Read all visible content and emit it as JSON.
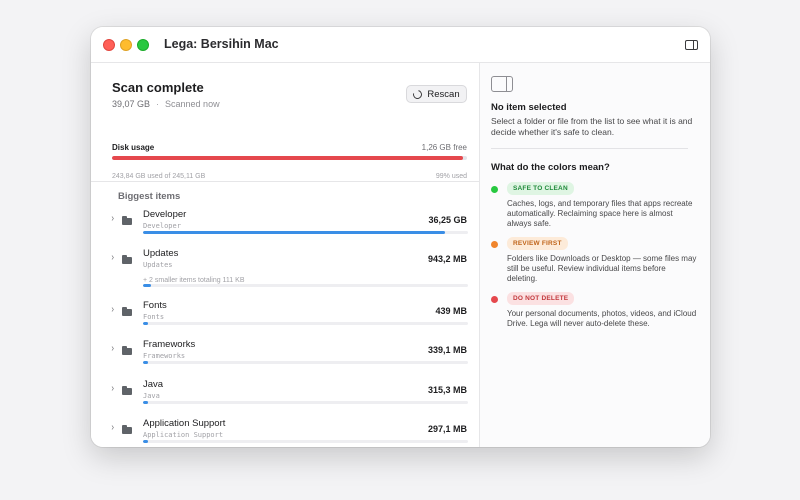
{
  "window": {
    "title": "Lega: Bersihin Mac"
  },
  "scan": {
    "title": "Scan complete",
    "size": "39,07 GB",
    "separator": "·",
    "status": "Scanned now",
    "rescan_label": "Rescan"
  },
  "disk": {
    "label": "Disk usage",
    "free": "1,26 GB free",
    "used_text": "243,84 GB used of 245,11 GB",
    "percent_text": "99% used",
    "used_fraction": 0.99
  },
  "biggest_title": "Biggest items",
  "items": [
    {
      "name": "Developer",
      "path": "Developer",
      "size": "36,25 GB",
      "fraction": 0.93,
      "extra": ""
    },
    {
      "name": "Updates",
      "path": "Updates",
      "size": "943,2 MB",
      "fraction": 0.026,
      "extra": "+ 2 smaller items totaling 111 KB"
    },
    {
      "name": "Fonts",
      "path": "Fonts",
      "size": "439 MB",
      "fraction": 0.012,
      "extra": ""
    },
    {
      "name": "Frameworks",
      "path": "Frameworks",
      "size": "339,1 MB",
      "fraction": 0.009,
      "extra": ""
    },
    {
      "name": "Java",
      "path": "Java",
      "size": "315,3 MB",
      "fraction": 0.009,
      "extra": ""
    },
    {
      "name": "Application Support",
      "path": "Application Support",
      "size": "297,1 MB",
      "fraction": 0.008,
      "extra": ""
    }
  ],
  "inspector": {
    "title": "No item selected",
    "desc": "Select a folder or file from the list to see what it is and decide whether it's safe to clean.",
    "colors_title": "What do the colors mean?",
    "legend": [
      {
        "badge": "SAFE TO CLEAN",
        "color": "#28c840",
        "badge_bg": "#dff5e3",
        "badge_fg": "#1f8a3a",
        "desc": "Caches, logs, and temporary files that apps recreate automatically. Reclaiming space here is almost always safe."
      },
      {
        "badge": "REVIEW FIRST",
        "color": "#f0852d",
        "badge_bg": "#fdebd9",
        "badge_fg": "#c0651b",
        "desc": "Folders like Downloads or Desktop — some files may still be useful. Review individual items before deleting."
      },
      {
        "badge": "DO NOT DELETE",
        "color": "#e5484d",
        "badge_bg": "#fbe1e2",
        "badge_fg": "#c2383c",
        "desc": "Your personal documents, photos, videos, and iCloud Drive. Lega will never auto-delete these."
      }
    ]
  },
  "icons": {
    "sidebar_toggle": "sidebar-right-icon",
    "rescan": "refresh-icon",
    "folder": "folder-icon",
    "chevron": "chevron-right-icon",
    "inspector": "inspector-panel-icon"
  }
}
